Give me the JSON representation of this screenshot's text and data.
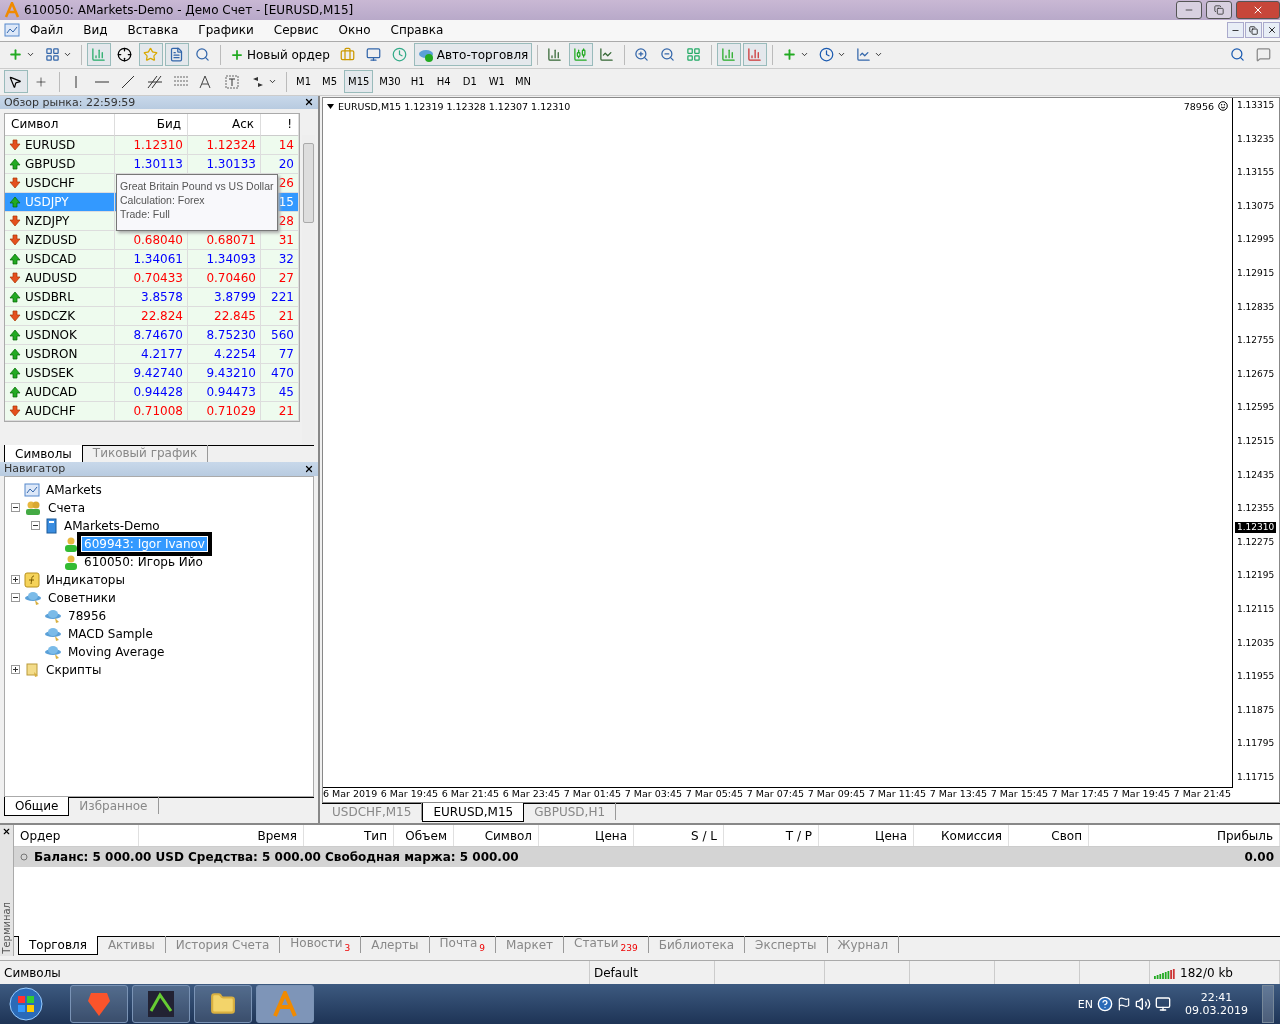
{
  "window": {
    "title": "610050: AMarkets-Demo - Демо Счет - [EURUSD,M15]"
  },
  "menu": [
    "Файл",
    "Вид",
    "Вставка",
    "Графики",
    "Сервис",
    "Окно",
    "Справка"
  ],
  "toolbar": {
    "new_order": "Новый ордер",
    "auto_trading": "Авто-торговля"
  },
  "timeframes": [
    {
      "label": "M1",
      "selected": false
    },
    {
      "label": "M5",
      "selected": false
    },
    {
      "label": "M15",
      "selected": true
    },
    {
      "label": "M30",
      "selected": false
    },
    {
      "label": "H1",
      "selected": false
    },
    {
      "label": "H4",
      "selected": false
    },
    {
      "label": "D1",
      "selected": false
    },
    {
      "label": "W1",
      "selected": false
    },
    {
      "label": "MN",
      "selected": false
    }
  ],
  "market_watch": {
    "title": "Обзор рынка: 22:59:59",
    "columns": [
      "Символ",
      "Бид",
      "Аск",
      "!"
    ],
    "rows": [
      {
        "symbol": "EURUSD",
        "rising": false,
        "bid": "1.12310",
        "ask": "1.12324",
        "spread": "14",
        "selected": false
      },
      {
        "symbol": "GBPUSD",
        "rising": true,
        "bid": "1.30113",
        "ask": "1.30133",
        "spread": "20",
        "selected": false
      },
      {
        "symbol": "USDCHF",
        "rising": false,
        "spread": "26",
        "selected": false
      },
      {
        "symbol": "USDJPY",
        "rising": true,
        "spread": "15",
        "selected": true
      },
      {
        "symbol": "NZDJPY",
        "rising": false,
        "spread": "28",
        "selected": false
      },
      {
        "symbol": "NZDUSD",
        "rising": false,
        "bid": "0.68040",
        "ask": "0.68071",
        "spread": "31",
        "selected": false
      },
      {
        "symbol": "USDCAD",
        "rising": true,
        "bid": "1.34061",
        "ask": "1.34093",
        "spread": "32",
        "selected": false
      },
      {
        "symbol": "AUDUSD",
        "rising": false,
        "bid": "0.70433",
        "ask": "0.70460",
        "spread": "27",
        "selected": false
      },
      {
        "symbol": "USDBRL",
        "rising": true,
        "bid": "3.8578",
        "ask": "3.8799",
        "spread": "221",
        "selected": false
      },
      {
        "symbol": "USDCZK",
        "rising": false,
        "bid": "22.824",
        "ask": "22.845",
        "spread": "21",
        "selected": false
      },
      {
        "symbol": "USDNOK",
        "rising": true,
        "bid": "8.74670",
        "ask": "8.75230",
        "spread": "560",
        "selected": false
      },
      {
        "symbol": "USDRON",
        "rising": true,
        "bid": "4.2177",
        "ask": "4.2254",
        "spread": "77",
        "selected": false
      },
      {
        "symbol": "USDSEK",
        "rising": true,
        "bid": "9.42740",
        "ask": "9.43210",
        "spread": "470",
        "selected": false
      },
      {
        "symbol": "AUDCAD",
        "rising": true,
        "bid": "0.94428",
        "ask": "0.94473",
        "spread": "45",
        "selected": false
      },
      {
        "symbol": "AUDCHF",
        "rising": false,
        "bid": "0.71008",
        "ask": "0.71029",
        "spread": "21",
        "selected": false
      }
    ],
    "tooltip": [
      "Great Britain Pound vs US Dollar",
      "Calculation: Forex",
      "Trade: Full"
    ],
    "tabs": [
      {
        "label": "Символы",
        "selected": true
      },
      {
        "label": "Тиковый график",
        "selected": false
      }
    ]
  },
  "navigator": {
    "title": "Навигатор",
    "tree": [
      {
        "label": "AMarkets",
        "kind": "root"
      },
      {
        "label": "Счета",
        "kind": "accounts",
        "expanded": true,
        "children": [
          {
            "label": "AMarkets-Demo",
            "kind": "server",
            "expanded": true,
            "children": [
              {
                "label": "609943: Igor Ivanov",
                "kind": "account",
                "selected": true
              },
              {
                "label": "610050: Игорь Ийо",
                "kind": "account",
                "selected": false
              }
            ]
          }
        ]
      },
      {
        "label": "Индикаторы",
        "kind": "indicators",
        "expanded": false
      },
      {
        "label": "Советники",
        "kind": "experts",
        "expanded": true,
        "children": [
          {
            "label": "78956",
            "kind": "expert"
          },
          {
            "label": "MACD Sample",
            "kind": "expert"
          },
          {
            "label": "Moving Average",
            "kind": "expert"
          }
        ]
      },
      {
        "label": "Скрипты",
        "kind": "scripts",
        "expanded": false
      }
    ],
    "tabs": [
      {
        "label": "Общие",
        "selected": true
      },
      {
        "label": "Избранное",
        "selected": false
      }
    ]
  },
  "chart": {
    "header": "EURUSD,M15  1.12319 1.12328 1.12307 1.12310",
    "expert": "78956",
    "price_labels": [
      {
        "text": "1.13315",
        "kind": "tick"
      },
      {
        "text": "1.13235",
        "kind": "tick"
      },
      {
        "text": "1.13155",
        "kind": "tick"
      },
      {
        "text": "1.13075",
        "kind": "tick"
      },
      {
        "text": "1.12995",
        "kind": "tick"
      },
      {
        "text": "1.12915",
        "kind": "tick"
      },
      {
        "text": "1.12835",
        "kind": "tick"
      },
      {
        "text": "1.12755",
        "kind": "tick"
      },
      {
        "text": "1.12675",
        "kind": "tick"
      },
      {
        "text": "1.12595",
        "kind": "tick"
      },
      {
        "text": "1.12515",
        "kind": "tick"
      },
      {
        "text": "1.12435",
        "kind": "tick"
      },
      {
        "text": "1.12355",
        "kind": "tick"
      },
      {
        "text": "1.12310",
        "kind": "current"
      },
      {
        "text": "1.12275",
        "kind": "tick"
      },
      {
        "text": "1.12195",
        "kind": "tick"
      },
      {
        "text": "1.12115",
        "kind": "tick"
      },
      {
        "text": "1.12035",
        "kind": "tick"
      },
      {
        "text": "1.11955",
        "kind": "tick"
      },
      {
        "text": "1.11875",
        "kind": "tick"
      },
      {
        "text": "1.11795",
        "kind": "tick"
      },
      {
        "text": "1.11715",
        "kind": "tick"
      }
    ],
    "time_labels": [
      "6 Mar 2019",
      "6 Mar 19:45",
      "6 Mar 21:45",
      "6 Mar 23:45",
      "7 Mar 01:45",
      "7 Mar 03:45",
      "7 Mar 05:45",
      "7 Mar 07:45",
      "7 Mar 09:45",
      "7 Mar 11:45",
      "7 Mar 13:45",
      "7 Mar 15:45",
      "7 Mar 17:45",
      "7 Mar 19:45",
      "7 Mar 21:45"
    ],
    "tabs": [
      {
        "label": "USDCHF,M15",
        "selected": false
      },
      {
        "label": "EURUSD,M15",
        "selected": true
      },
      {
        "label": "GBPUSD,H1",
        "selected": false
      }
    ]
  },
  "terminal": {
    "side_label": "Терминал",
    "columns": [
      "Ордер",
      "Время",
      "Тип",
      "Объем",
      "Символ",
      "Цена",
      "S / L",
      "T / P",
      "Цена",
      "Комиссия",
      "Своп",
      "Прибыль"
    ],
    "balance": "Баланс: 5 000.00 USD  Средства: 5 000.00  Свободная маржа: 5 000.00",
    "profit": "0.00",
    "tabs": [
      {
        "label": "Торговля",
        "selected": true
      },
      {
        "label": "Активы",
        "selected": false
      },
      {
        "label": "История Счета",
        "selected": false
      },
      {
        "label": "Новости",
        "badge": "3",
        "selected": false
      },
      {
        "label": "Алерты",
        "selected": false
      },
      {
        "label": "Почта",
        "badge": "9",
        "selected": false
      },
      {
        "label": "Маркет",
        "selected": false
      },
      {
        "label": "Статьи",
        "badge": "239",
        "selected": false
      },
      {
        "label": "Библиотека",
        "selected": false
      },
      {
        "label": "Эксперты",
        "selected": false
      },
      {
        "label": "Журнал",
        "selected": false
      }
    ]
  },
  "status_bar": {
    "left": "Символы",
    "profile": "Default",
    "traffic": "182/0 kb"
  },
  "taskbar": {
    "language": "EN",
    "time": "22:41",
    "date": "09.03.2019"
  }
}
